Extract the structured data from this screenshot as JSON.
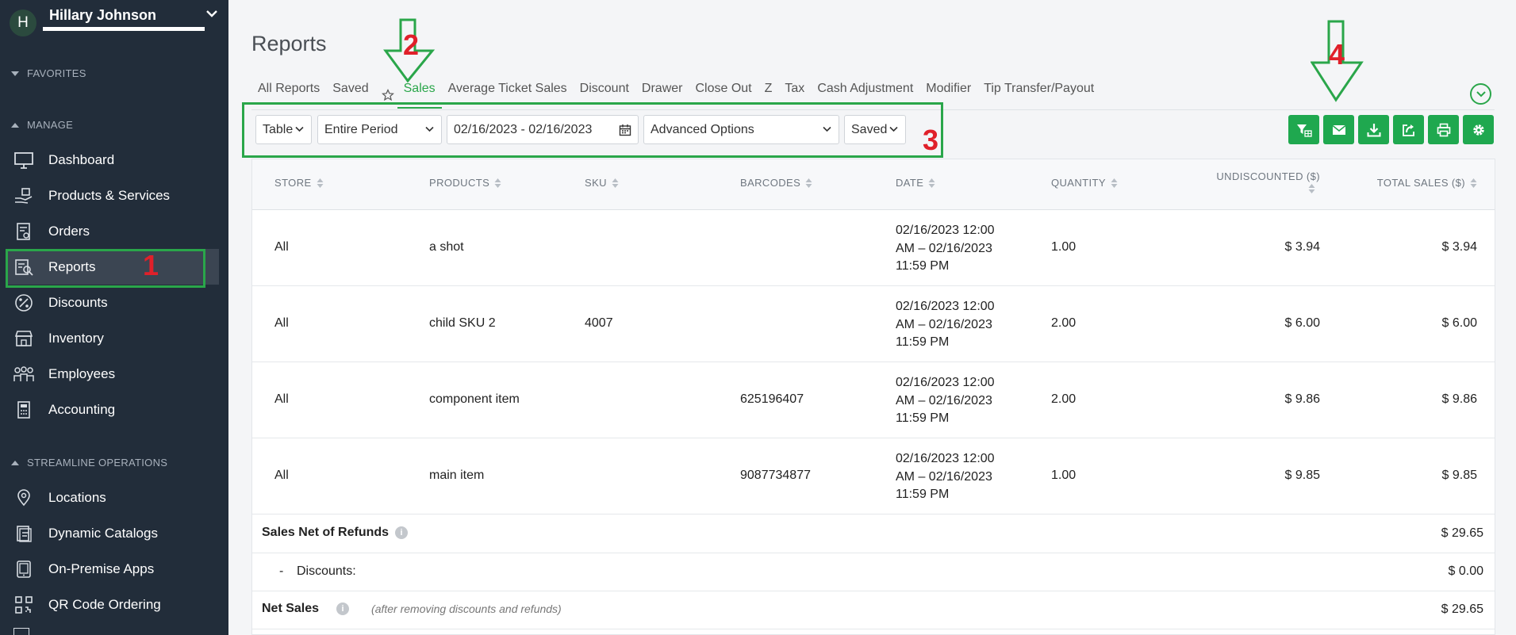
{
  "user": {
    "initial": "H",
    "name": "Hillary Johnson"
  },
  "sidebar": {
    "favorites": "FAVORITES",
    "manage": "MANAGE",
    "streamline": "STREAMLINE OPERATIONS",
    "items": [
      {
        "label": "Dashboard",
        "icon": "monitor-icon"
      },
      {
        "label": "Products & Services",
        "icon": "hand-box-icon"
      },
      {
        "label": "Orders",
        "icon": "order-doc-icon"
      },
      {
        "label": "Reports",
        "icon": "report-icon"
      },
      {
        "label": "Discounts",
        "icon": "percent-icon"
      },
      {
        "label": "Inventory",
        "icon": "store-icon"
      },
      {
        "label": "Employees",
        "icon": "people-icon"
      },
      {
        "label": "Accounting",
        "icon": "calculator-icon"
      }
    ],
    "streamline_items": [
      {
        "label": "Locations",
        "icon": "location-pin-icon"
      },
      {
        "label": "Dynamic Catalogs",
        "icon": "catalog-icon"
      },
      {
        "label": "On-Premise Apps",
        "icon": "tablet-icon"
      },
      {
        "label": "QR Code Ordering",
        "icon": "qr-code-icon"
      }
    ]
  },
  "annotations": {
    "n1": "1",
    "n2": "2",
    "n3": "3",
    "n4": "4",
    "color_box": "#2aa64a",
    "color_num": "#e0202a"
  },
  "page": {
    "title": "Reports"
  },
  "tabs": [
    "All Reports",
    "Saved",
    "Sales",
    "Average Ticket Sales",
    "Discount",
    "Drawer",
    "Close Out",
    "Z",
    "Tax",
    "Cash Adjustment",
    "Modifier",
    "Tip Transfer/Payout"
  ],
  "active_tab": "Sales",
  "filters": {
    "view": "Table",
    "period": "Entire Period",
    "date_range": "02/16/2023 - 02/16/2023",
    "advanced": "Advanced Options",
    "saved": "Saved"
  },
  "toolbar": [
    "filter-table-icon",
    "email-icon",
    "download-icon",
    "share-icon",
    "print-icon",
    "settings-icon"
  ],
  "accent": "#1fa84f",
  "table": {
    "headers": [
      "STORE",
      "PRODUCTS",
      "SKU",
      "BARCODES",
      "DATE",
      "QUANTITY",
      "UNDISCOUNTED ($)",
      "TOTAL SALES ($)"
    ],
    "rows": [
      {
        "store": "All",
        "product": "a shot",
        "sku": "",
        "barcode": "",
        "date": [
          "02/16/2023 12:00",
          "AM – 02/16/2023",
          "11:59 PM"
        ],
        "qty": "1.00",
        "undiscounted": "$ 3.94",
        "total": "$ 3.94"
      },
      {
        "store": "All",
        "product": "child SKU 2",
        "sku": "4007",
        "barcode": "",
        "date": [
          "02/16/2023 12:00",
          "AM – 02/16/2023",
          "11:59 PM"
        ],
        "qty": "2.00",
        "undiscounted": "$ 6.00",
        "total": "$ 6.00"
      },
      {
        "store": "All",
        "product": "component item",
        "sku": "",
        "barcode": "625196407",
        "date": [
          "02/16/2023 12:00",
          "AM – 02/16/2023",
          "11:59 PM"
        ],
        "qty": "2.00",
        "undiscounted": "$ 9.86",
        "total": "$ 9.86"
      },
      {
        "store": "All",
        "product": "main item",
        "sku": "",
        "barcode": "9087734877",
        "date": [
          "02/16/2023 12:00",
          "AM – 02/16/2023",
          "11:59 PM"
        ],
        "qty": "1.00",
        "undiscounted": "$ 9.85",
        "total": "$ 9.85"
      }
    ]
  },
  "summary": {
    "net_of_refunds_label": "Sales Net of Refunds",
    "net_of_refunds_value": "$ 29.65",
    "discounts_dash": "-",
    "discounts_label": "Discounts:",
    "discounts_value": "$ 0.00",
    "net_sales_label": "Net Sales",
    "net_sales_note": "(after removing discounts and refunds)",
    "net_sales_value": "$ 29.65"
  }
}
